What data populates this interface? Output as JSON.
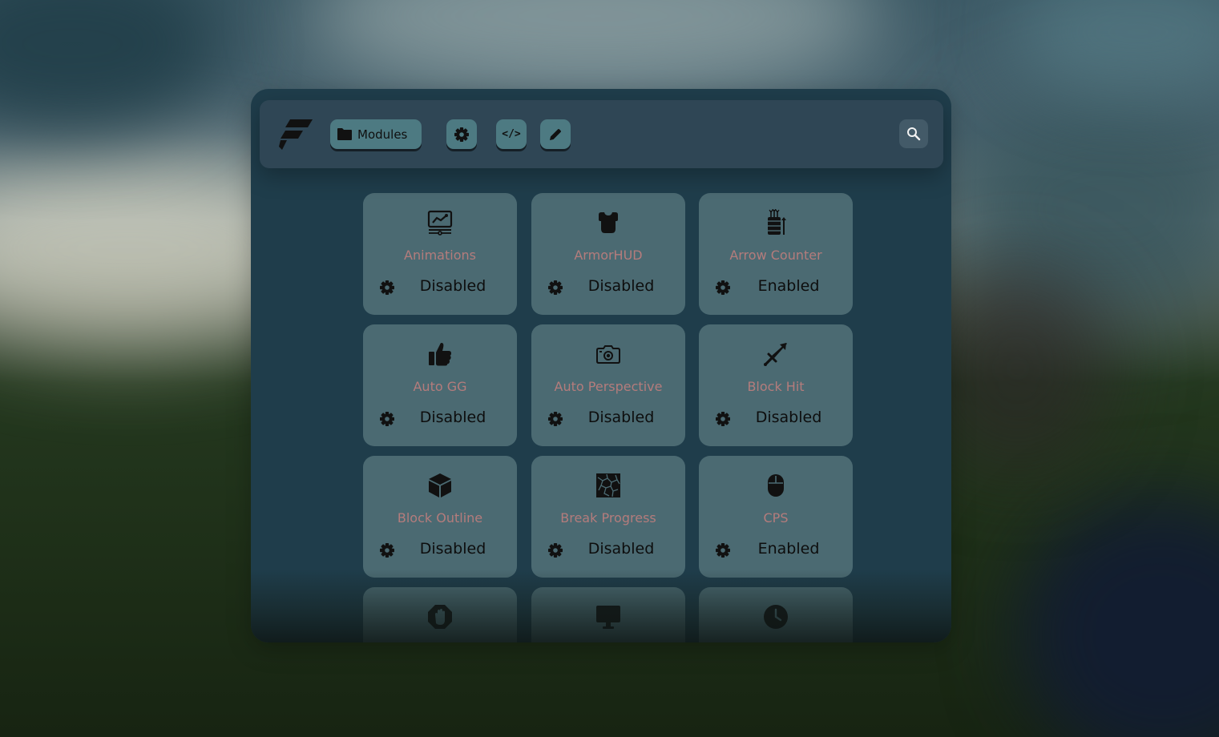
{
  "header": {
    "tabs": [
      {
        "label": "Modules",
        "icon": "folder-icon",
        "active": true
      },
      {
        "label": "",
        "icon": "gear-icon"
      },
      {
        "label": "",
        "icon": "code-icon",
        "glyph": "</>"
      },
      {
        "label": "",
        "icon": "pencil-icon"
      }
    ],
    "search_icon": "search-icon"
  },
  "modules": [
    {
      "name": "Animations",
      "status": "Disabled",
      "icon": "monitor-chart-icon"
    },
    {
      "name": "ArmorHUD",
      "status": "Disabled",
      "icon": "chestplate-icon"
    },
    {
      "name": "Arrow Counter",
      "status": "Enabled",
      "icon": "quiver-icon"
    },
    {
      "name": "Auto GG",
      "status": "Disabled",
      "icon": "thumbs-up-icon"
    },
    {
      "name": "Auto Perspective",
      "status": "Disabled",
      "icon": "camera-icon"
    },
    {
      "name": "Block Hit",
      "status": "Disabled",
      "icon": "sword-icon"
    },
    {
      "name": "Block Outline",
      "status": "Disabled",
      "icon": "cube-icon"
    },
    {
      "name": "Break Progress",
      "status": "Disabled",
      "icon": "cracked-block-icon"
    },
    {
      "name": "CPS",
      "status": "Enabled",
      "icon": "mouse-icon"
    },
    {
      "name": "",
      "status": "",
      "icon": "hand-stop-icon"
    },
    {
      "name": "",
      "status": "",
      "icon": "monitor-icon"
    },
    {
      "name": "",
      "status": "",
      "icon": "clock-icon"
    }
  ],
  "colors": {
    "panel": "#1f3d4b",
    "topbar": "#2f4655",
    "card": "#4b6a72",
    "button": "#4d7a82",
    "module_name": "#b47c7c"
  }
}
